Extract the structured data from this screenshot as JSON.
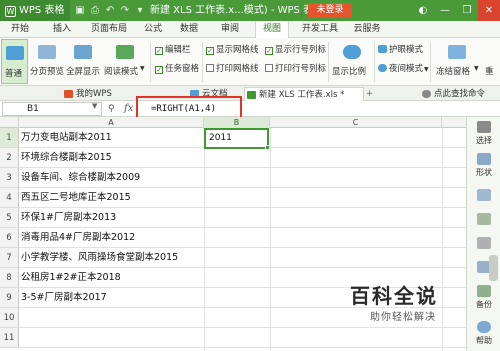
{
  "titlebar": {
    "app_name": "WPS 表格",
    "app_logo": "W",
    "doc_title": "新建 XLS 工作表.x...模式) - WPS 表格",
    "login_label": "未登录"
  },
  "menu_tabs": [
    "开始",
    "插入",
    "页面布局",
    "公式",
    "数据",
    "审阅",
    "视图",
    "开发工具",
    "云服务"
  ],
  "ribbon": {
    "normal": "普通",
    "page_break": "分页预览",
    "fullscreen": "全屏显示",
    "reading_mode": "阅读模式",
    "edit_bar": "编辑栏",
    "task_pane": "任务窗格",
    "show_gridlines": "显示网格线",
    "print_gridlines": "打印网格线",
    "show_headings": "显示行号列标",
    "print_headings": "打印行号列标",
    "zoom": "显示比例",
    "eye_protect": "护眼模式",
    "night_mode": "夜间模式",
    "freeze": "冻结窗格",
    "re": "重"
  },
  "doc_tabs": [
    "我的WPS",
    "云文档",
    "新建 XLS 工作表.xls *",
    "点此查找命令"
  ],
  "formula_bar": {
    "name_box": "B1",
    "fx": "fx",
    "formula": "=RIGHT(A1,4)"
  },
  "columns": [
    "A",
    "B",
    "C"
  ],
  "rows": [
    {
      "num": "1",
      "a": "万力变电站副本2011",
      "b": "2011"
    },
    {
      "num": "2",
      "a": "环境综合楼副本2015",
      "b": ""
    },
    {
      "num": "3",
      "a": "设备车间、综合楼副本2009",
      "b": ""
    },
    {
      "num": "4",
      "a": "西五区二号地库正本2015",
      "b": ""
    },
    {
      "num": "5",
      "a": "环保1#厂房副本2013",
      "b": ""
    },
    {
      "num": "6",
      "a": "消毒用品4#厂房副本2012",
      "b": ""
    },
    {
      "num": "7",
      "a": "小学教学楼、风雨操场食堂副本2015",
      "b": ""
    },
    {
      "num": "8",
      "a": "公租房1#2#正本2018",
      "b": ""
    },
    {
      "num": "9",
      "a": "3-5#厂房副本2017",
      "b": ""
    },
    {
      "num": "10",
      "a": "",
      "b": ""
    },
    {
      "num": "11",
      "a": "",
      "b": ""
    }
  ],
  "side_panel": [
    "选择",
    "形状",
    "",
    "",
    "",
    "",
    "",
    "备份",
    "帮助"
  ],
  "watermark": {
    "title": "百科全说",
    "subtitle": "助你轻松解决"
  }
}
